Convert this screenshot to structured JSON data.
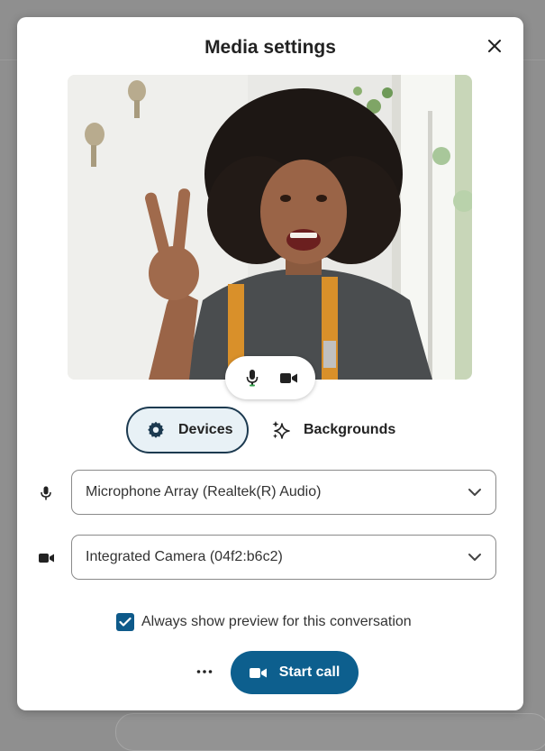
{
  "dialog": {
    "title": "Media settings"
  },
  "preview": {
    "image": "webcam-preview",
    "mic_icon": "microphone-icon",
    "camera_icon": "video-camera-icon"
  },
  "tabs": [
    {
      "label": "Devices",
      "icon": "gear-icon",
      "active": true
    },
    {
      "label": "Backgrounds",
      "icon": "sparkle-icon",
      "active": false
    }
  ],
  "devices": {
    "microphone": {
      "value": "Microphone Array (Realtek(R) Audio)",
      "icon": "microphone-icon"
    },
    "camera": {
      "value": "Integrated Camera (04f2:b6c2)",
      "icon": "video-camera-icon"
    }
  },
  "preview_option": {
    "label": "Always show preview for this conversation",
    "checked": true
  },
  "actions": {
    "start_call_label": "Start call"
  },
  "colors": {
    "accent": "#0d5f8e",
    "active_tab_bg": "#e8f1f6",
    "mic_active": "#2e9e48"
  }
}
